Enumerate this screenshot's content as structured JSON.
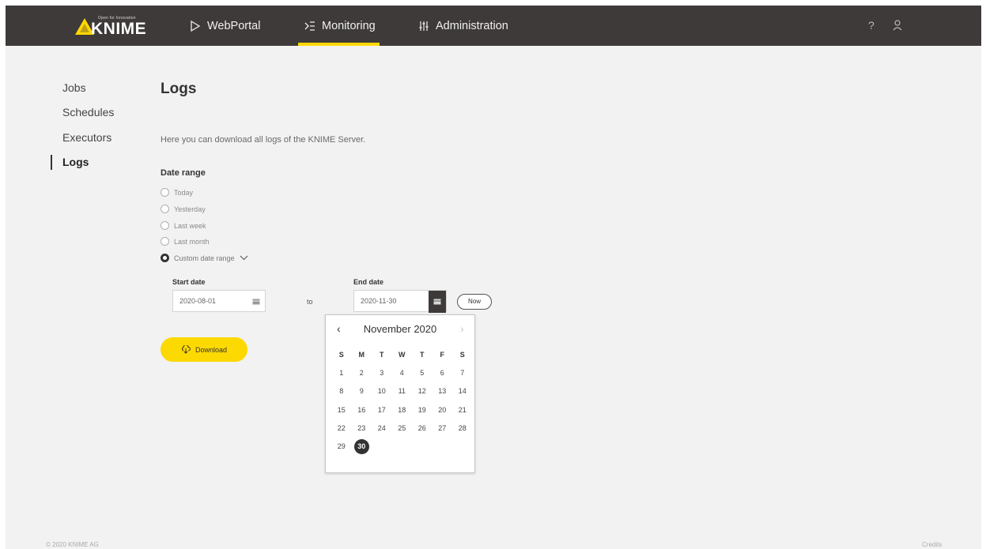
{
  "header": {
    "logo_tag": "Open for Innovation",
    "logo_text": "KNIME",
    "nav": [
      {
        "label": "WebPortal",
        "icon": "play-outline-icon"
      },
      {
        "label": "Monitoring",
        "icon": "monitoring-icon",
        "active": true
      },
      {
        "label": "Administration",
        "icon": "sliders-icon"
      }
    ],
    "help_label": "?",
    "colors": {
      "bar": "#3e3a39",
      "accent": "#ffd800"
    }
  },
  "sidebar": {
    "items": [
      {
        "label": "Jobs"
      },
      {
        "label": "Schedules"
      },
      {
        "label": "Executors"
      },
      {
        "label": "Logs",
        "active": true
      }
    ]
  },
  "main": {
    "title": "Logs",
    "intro": "Here you can download all logs of the KNIME Server.",
    "date_range_label": "Date range",
    "options": [
      "Today",
      "Yesterday",
      "Last week",
      "Last month",
      "Custom date range"
    ],
    "selected_option": "Custom date range",
    "start_label": "Start date",
    "start_value": "2020-08-01",
    "to_label": "to",
    "end_label": "End date",
    "end_value": "2020-11-30",
    "now_label": "Now",
    "download_label": "Download"
  },
  "calendar": {
    "month_label": "November 2020",
    "weekdays": [
      "S",
      "M",
      "T",
      "W",
      "T",
      "F",
      "S"
    ],
    "days": [
      "1",
      "2",
      "3",
      "4",
      "5",
      "6",
      "7",
      "8",
      "9",
      "10",
      "11",
      "12",
      "13",
      "14",
      "15",
      "16",
      "17",
      "18",
      "19",
      "20",
      "21",
      "22",
      "23",
      "24",
      "25",
      "26",
      "27",
      "28",
      "29",
      "30"
    ],
    "selected_day": "30"
  },
  "footer": {
    "copyright": "© 2020 KNIME AG",
    "credits": "Credits"
  }
}
